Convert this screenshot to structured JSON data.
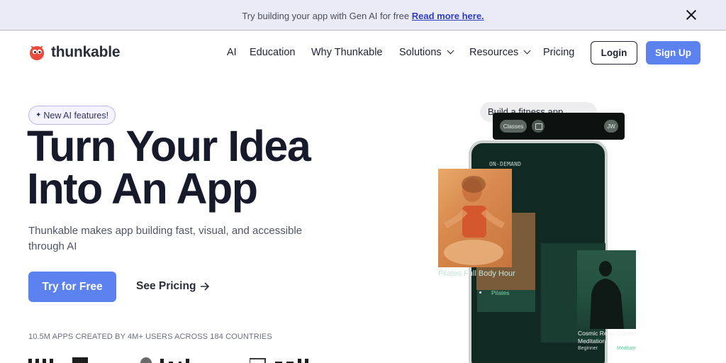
{
  "banner": {
    "text": "Try building your app with Gen AI for free",
    "link": "Read more here."
  },
  "nav": {
    "brand": "thunkable",
    "items": [
      "AI",
      "Education",
      "Why Thunkable",
      "Solutions",
      "Resources",
      "Pricing"
    ],
    "login": "Login",
    "signup": "Sign Up"
  },
  "hero": {
    "pill": "New AI features!",
    "title_line1": "Turn Your Idea",
    "title_line2": "Into An App",
    "subtitle": "Thunkable makes app building fast, visual, and accessible through AI",
    "cta_primary": "Try for Free",
    "cta_secondary": "See Pricing",
    "stats": "10.5M APPS CREATED BY 4M+ USERS ACROSS 184 COUNTRIES"
  },
  "illustration": {
    "prompt": "Build a fitness app",
    "toolbar_classes": "Classes",
    "toolbar_avatar": "JW",
    "phone_header": "ON-DEMAND",
    "card1_title": "Pilates Full Body Hour",
    "card1_tag": "Pilates",
    "card2_title": "Cosmic Relax Guided Meditation",
    "card2_level": "Beginner",
    "card2_tag": "Meditate"
  },
  "colors": {
    "accent": "#5b82ee",
    "banner_bg": "#ebebf8",
    "phone_bg": "#112923"
  }
}
